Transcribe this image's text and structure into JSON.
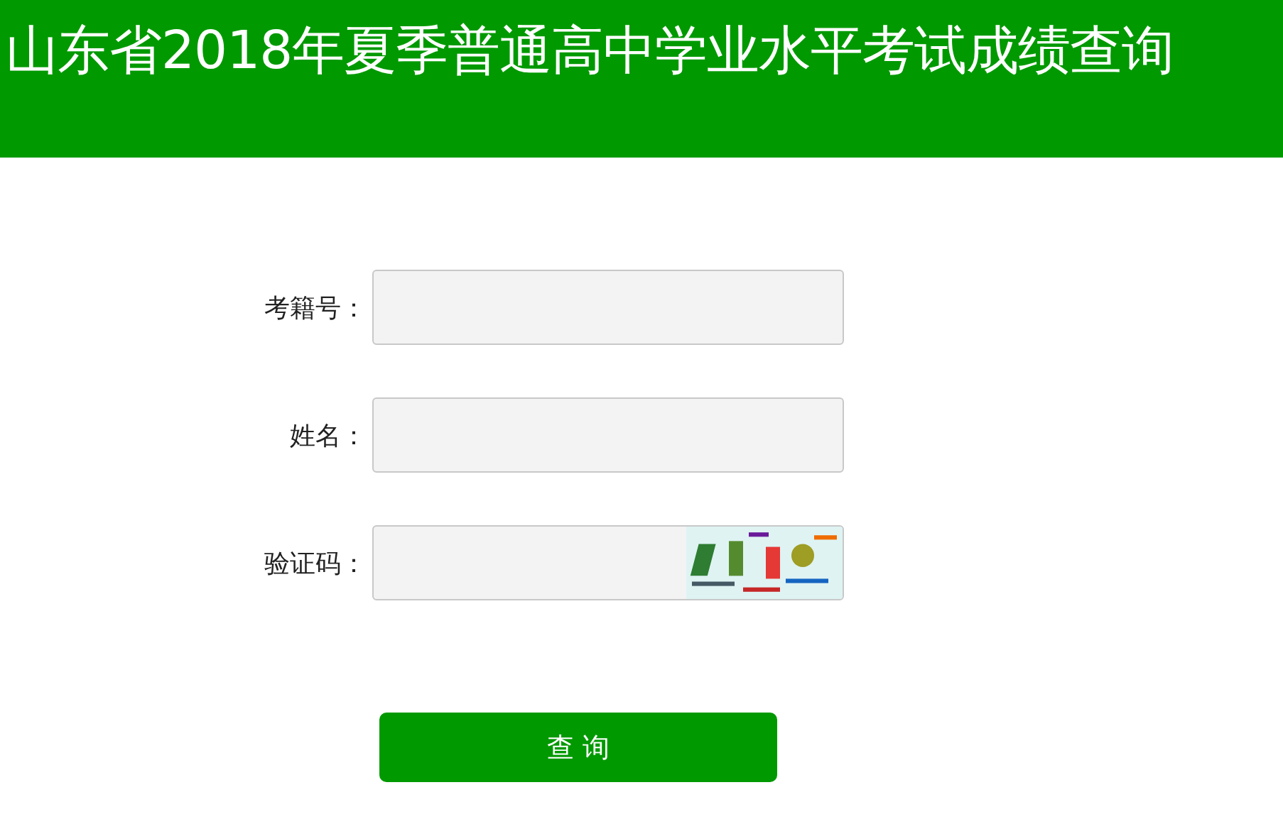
{
  "header": {
    "title": "山东省2018年夏季普通高中学业水平考试成绩查询"
  },
  "fields": [
    {
      "label": "考籍号：",
      "kind": "text"
    },
    {
      "label": "姓名：",
      "kind": "text"
    },
    {
      "label": "验证码：",
      "kind": "captcha"
    }
  ],
  "submit_button": {
    "label": "查 询"
  }
}
